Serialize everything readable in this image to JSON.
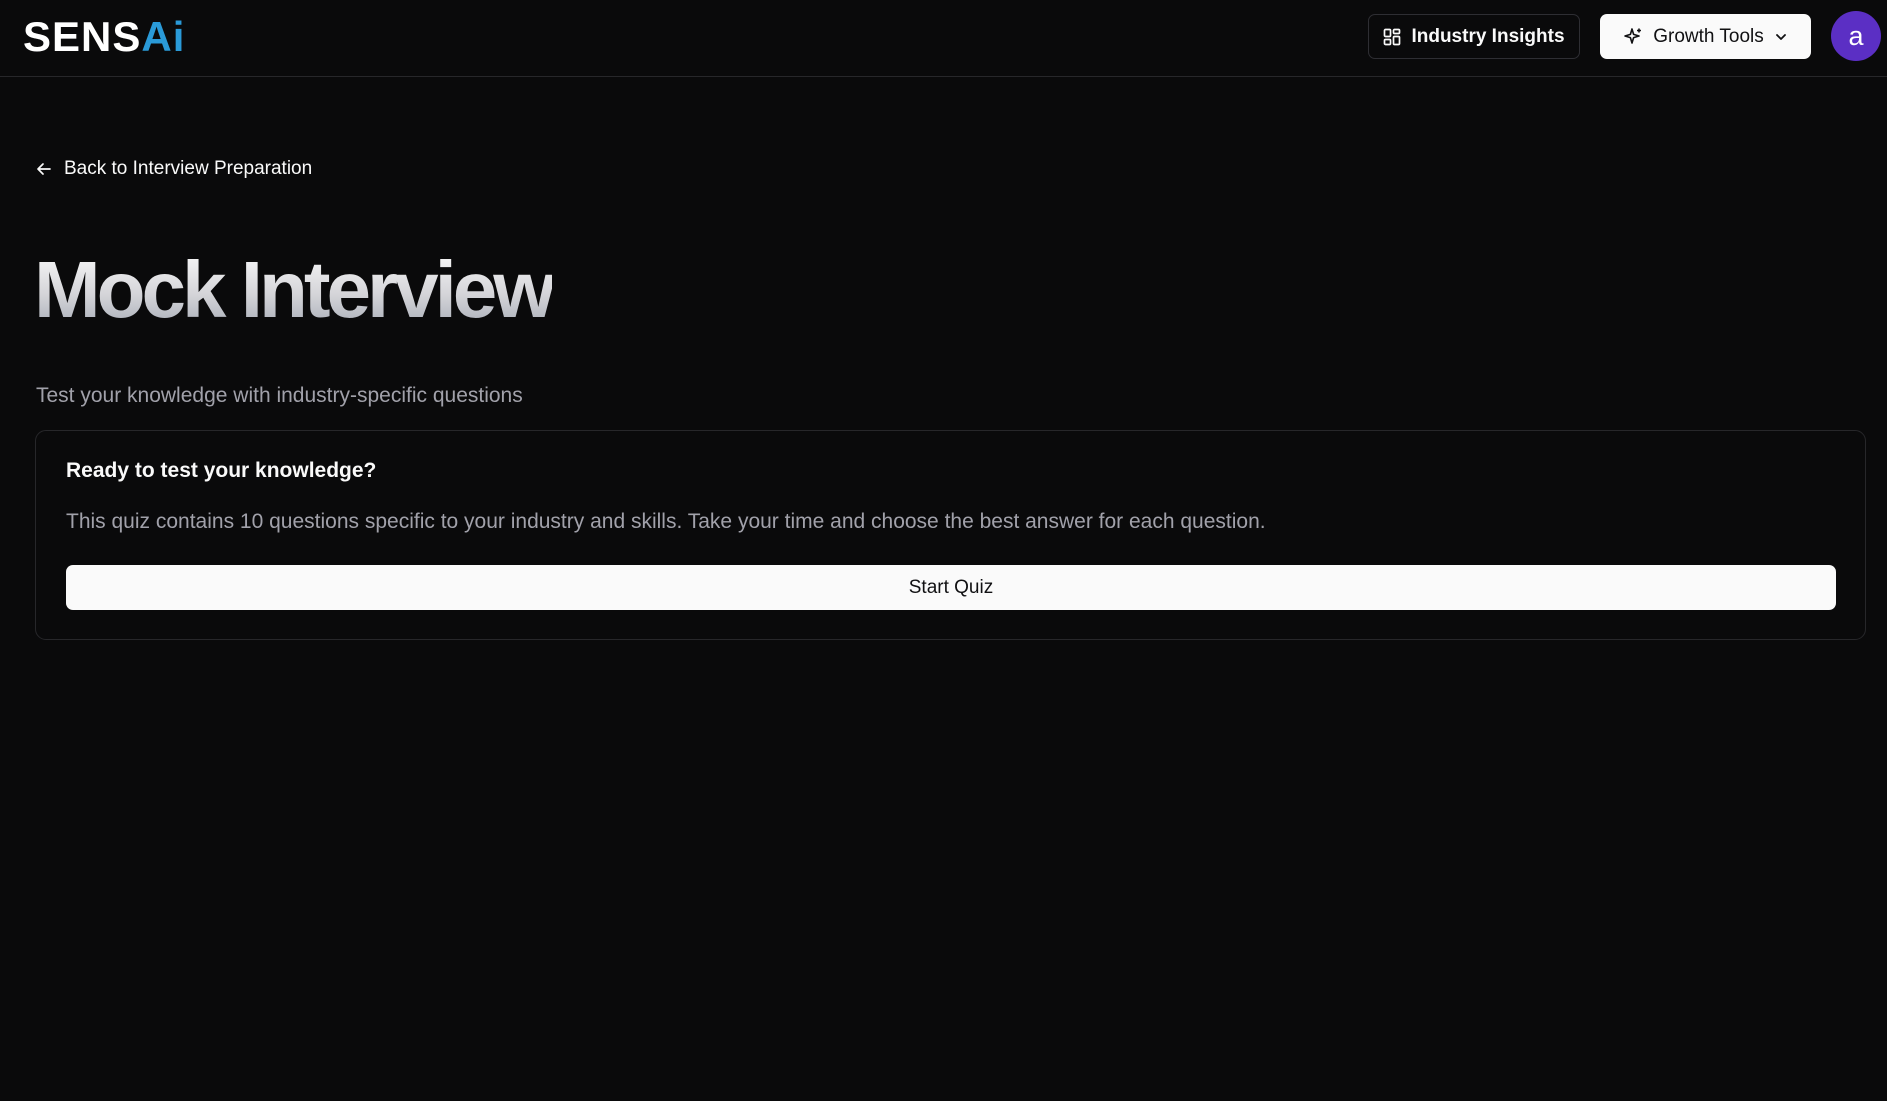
{
  "app": {
    "logo_primary": "SENS",
    "logo_accent": "Ai",
    "accent_color": "#2a9ad8",
    "avatar_color": "#5b2fc4"
  },
  "header": {
    "industry_insights_label": "Industry Insights",
    "industry_insights_icon": "layout-dashboard-icon",
    "growth_tools_label": "Growth Tools",
    "growth_tools_icon": "sparkles-icon",
    "growth_tools_chevron": "chevron-down-icon",
    "avatar_initial": "a"
  },
  "main": {
    "back_link_label": "Back to Interview Preparation",
    "back_link_icon": "arrow-left-icon",
    "title": "Mock Interview",
    "subtitle": "Test your knowledge with industry-specific questions"
  },
  "quiz_card": {
    "title": "Ready to test your knowledge?",
    "description": "This quiz contains 10 questions specific to your industry and skills. Take your time and choose the best answer for each question.",
    "start_button_label": "Start Quiz"
  }
}
